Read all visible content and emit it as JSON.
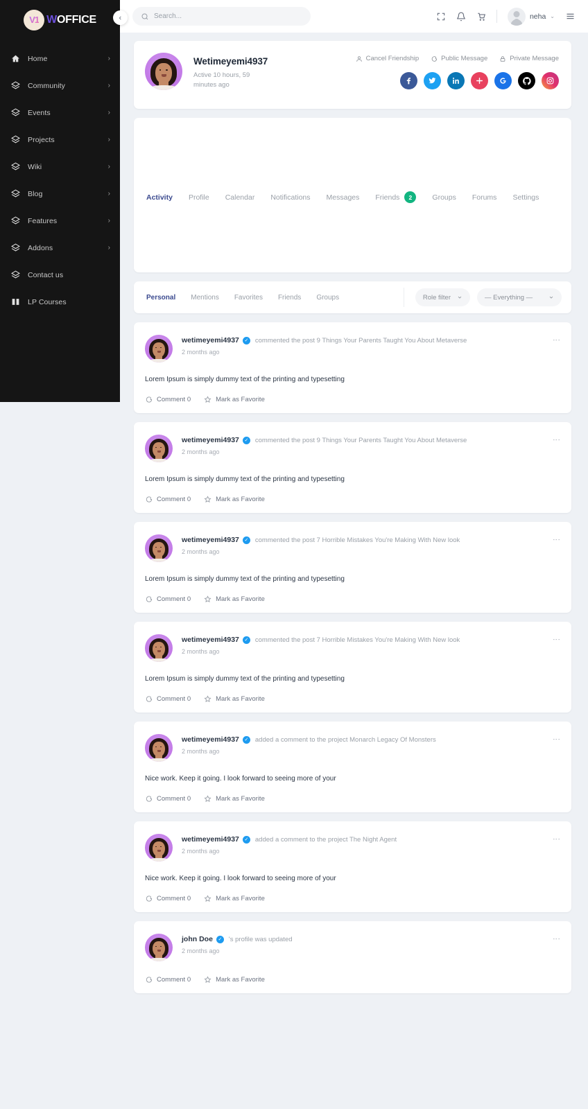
{
  "brand": {
    "mark": "V1",
    "w": "W",
    "rest": "OFFICE"
  },
  "sidebar": {
    "collapse_icon": "chevron-left-icon",
    "items": [
      {
        "label": "Home",
        "icon": "home-icon",
        "chevron": "›"
      },
      {
        "label": "Community",
        "icon": "layers-icon",
        "chevron": "›"
      },
      {
        "label": "Events",
        "icon": "layers-icon",
        "chevron": "›"
      },
      {
        "label": "Projects",
        "icon": "layers-icon",
        "chevron": "›"
      },
      {
        "label": "Wiki",
        "icon": "layers-icon",
        "chevron": "›"
      },
      {
        "label": "Blog",
        "icon": "layers-icon",
        "chevron": "›"
      },
      {
        "label": "Features",
        "icon": "layers-icon",
        "chevron": "›"
      },
      {
        "label": "Addons",
        "icon": "layers-icon",
        "chevron": "›"
      },
      {
        "label": "Contact us",
        "icon": "layers-icon",
        "chevron": ""
      },
      {
        "label": "LP Courses",
        "icon": "book-icon",
        "chevron": ""
      }
    ]
  },
  "topbar": {
    "search_placeholder": "Search...",
    "search_value": "",
    "icons": [
      "fullscreen-icon",
      "bell-icon",
      "cart-icon"
    ],
    "user_name": "neha",
    "caret": "⌄",
    "menu_icon": "hamburger-menu-icon"
  },
  "profile": {
    "name": "Wetimeyemi4937",
    "active_text": "Active 10 hours, 59 minutes ago",
    "actions": [
      {
        "label": "Cancel Friendship",
        "icon": "user-icon"
      },
      {
        "label": "Public Message",
        "icon": "chat-bubble-icon"
      },
      {
        "label": "Private Message",
        "icon": "lock-icon"
      }
    ],
    "socials": [
      {
        "name": "facebook",
        "glyph": "f",
        "color": "#3b5998"
      },
      {
        "name": "twitter",
        "glyph": "ᴛ",
        "color": "#1da1f2"
      },
      {
        "name": "linkedin",
        "glyph": "in",
        "color": "#0a77b5"
      },
      {
        "name": "dribbble",
        "glyph": "✿",
        "color": "#e8415e"
      },
      {
        "name": "google",
        "glyph": "G",
        "color": "#1a73e8"
      },
      {
        "name": "github",
        "glyph": "●",
        "color": "#000000"
      },
      {
        "name": "instagram",
        "glyph": "▢",
        "color": "#e1306c"
      }
    ]
  },
  "tabs": [
    {
      "label": "Activity",
      "active": true,
      "badge": ""
    },
    {
      "label": "Profile",
      "active": false,
      "badge": ""
    },
    {
      "label": "Calendar",
      "active": false,
      "badge": ""
    },
    {
      "label": "Notifications",
      "active": false,
      "badge": ""
    },
    {
      "label": "Messages",
      "active": false,
      "badge": ""
    },
    {
      "label": "Friends",
      "active": false,
      "badge": "2"
    },
    {
      "label": "Groups",
      "active": false,
      "badge": ""
    },
    {
      "label": "Forums",
      "active": false,
      "badge": ""
    },
    {
      "label": "Settings",
      "active": false,
      "badge": ""
    }
  ],
  "filters": {
    "sub_tabs": [
      {
        "label": "Personal",
        "active": true
      },
      {
        "label": "Mentions",
        "active": false
      },
      {
        "label": "Favorites",
        "active": false
      },
      {
        "label": "Friends",
        "active": false
      },
      {
        "label": "Groups",
        "active": false
      }
    ],
    "role_filter": "Role filter",
    "everything": "— Everything —"
  },
  "footer_actions": {
    "comment": "Comment 0",
    "favorite": "Mark as Favorite"
  },
  "activities": [
    {
      "user": "wetimeyemi4937",
      "description": "commented the post 9 Things Your Parents Taught You  About Metaverse",
      "time": "2 months ago",
      "body": "Lorem Ipsum is simply dummy text of the  printing and typesetting",
      "verified": true
    },
    {
      "user": "wetimeyemi4937",
      "description": "commented the post 9 Things Your Parents Taught You  About Metaverse",
      "time": "2 months ago",
      "body": "Lorem Ipsum is simply dummy text of the  printing and typesetting",
      "verified": true
    },
    {
      "user": "wetimeyemi4937",
      "description": "commented the post 7 Horrible Mistakes You're Making  With New look",
      "time": "2 months ago",
      "body": "Lorem Ipsum is simply dummy text of the  printing and typesetting",
      "verified": true
    },
    {
      "user": "wetimeyemi4937",
      "description": "commented the post 7 Horrible Mistakes You're Making  With New look",
      "time": "2 months ago",
      "body": "Lorem Ipsum is simply dummy text of the  printing and typesetting",
      "verified": true
    },
    {
      "user": "wetimeyemi4937",
      "description": "added a comment to the project Monarch Legacy Of Monsters",
      "time": "2 months ago",
      "body": "Nice work. Keep it going. I look forward to seeing more of your",
      "verified": true
    },
    {
      "user": "wetimeyemi4937",
      "description": "added a comment to the project The Night Agent",
      "time": "2 months ago",
      "body": "Nice work. Keep it going. I look forward to seeing more of your",
      "verified": true
    },
    {
      "user": "john Doe",
      "description": "'s profile was updated",
      "time": "2 months ago",
      "body": "",
      "verified": true
    }
  ]
}
